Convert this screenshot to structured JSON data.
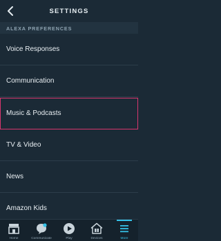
{
  "header": {
    "title": "SETTINGS"
  },
  "section": {
    "label": "ALEXA PREFERENCES"
  },
  "rows": [
    {
      "label": "Voice Responses"
    },
    {
      "label": "Communication"
    },
    {
      "label": "Music & Podcasts"
    },
    {
      "label": "TV & Video"
    },
    {
      "label": "News"
    },
    {
      "label": "Amazon Kids"
    }
  ],
  "tabs": [
    {
      "label": "Home",
      "icon": "home-icon"
    },
    {
      "label": "Communicate",
      "icon": "chat-icon"
    },
    {
      "label": "Play",
      "icon": "play-icon"
    },
    {
      "label": "Devices",
      "icon": "devices-icon"
    },
    {
      "label": "More",
      "icon": "menu-icon",
      "active": true
    }
  ],
  "colors": {
    "background": "#1b2a36",
    "highlight": "#d9366e",
    "accent": "#35c2e8"
  }
}
